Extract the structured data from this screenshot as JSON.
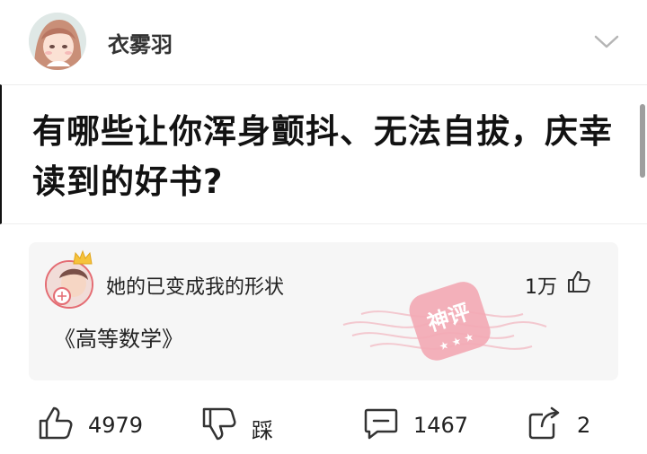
{
  "author": {
    "name": "衣雾羽",
    "avatar_icon": "anime-girl-avatar",
    "collapse_icon": "chevron-down-icon"
  },
  "question": {
    "title": "有哪些让你浑身颤抖、无法自拔，庆幸读到的好书?"
  },
  "top_comment": {
    "user_name": "她的已变成我的形状",
    "avatar_icon": "user-avatar-with-crown",
    "likes": "1万",
    "text": "《高等数学》",
    "stamp_label": "神评"
  },
  "actions": {
    "like_count": "4979",
    "dislike_label": "踩",
    "comment_count": "1467",
    "share_count": "2"
  },
  "colors": {
    "accent_red": "#e46c73",
    "stamp_pink": "#f3a9b4",
    "card_bg": "#f6f6f6"
  }
}
